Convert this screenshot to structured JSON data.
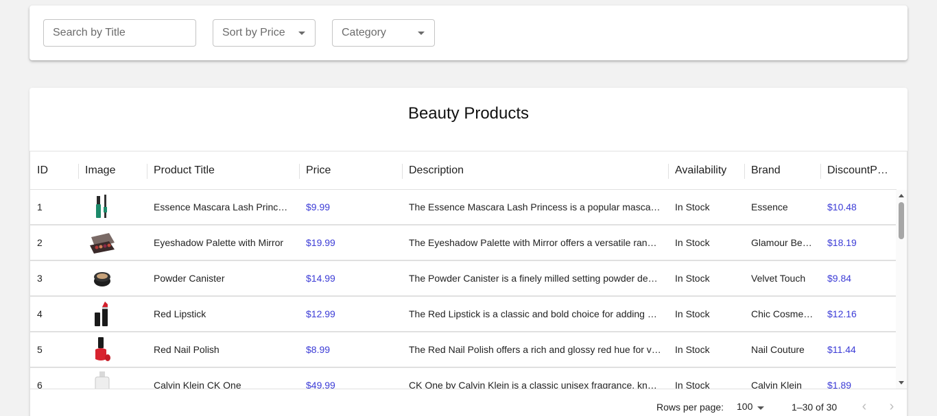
{
  "filters": {
    "search_placeholder": "Search by Title",
    "sort_label": "Sort by Price",
    "category_label": "Category"
  },
  "table": {
    "title": "Beauty Products",
    "columns": [
      "ID",
      "Image",
      "Product Title",
      "Price",
      "Description",
      "Availability",
      "Brand",
      "DiscountP…"
    ],
    "rows": [
      {
        "id": "1",
        "image": "mascara-thumbnail",
        "title": "Essence Mascara Lash Princ…",
        "price": "$9.99",
        "description": "The Essence Mascara Lash Princess is a popular masca…",
        "availability": "In Stock",
        "brand": "Essence",
        "discount": "$10.48"
      },
      {
        "id": "2",
        "image": "eyeshadow-palette-thumbnail",
        "title": "Eyeshadow Palette with Mirror",
        "price": "$19.99",
        "description": "The Eyeshadow Palette with Mirror offers a versatile ran…",
        "availability": "In Stock",
        "brand": "Glamour Be…",
        "discount": "$18.19"
      },
      {
        "id": "3",
        "image": "powder-canister-thumbnail",
        "title": "Powder Canister",
        "price": "$14.99",
        "description": "The Powder Canister is a finely milled setting powder de…",
        "availability": "In Stock",
        "brand": "Velvet Touch",
        "discount": "$9.84"
      },
      {
        "id": "4",
        "image": "red-lipstick-thumbnail",
        "title": "Red Lipstick",
        "price": "$12.99",
        "description": "The Red Lipstick is a classic and bold choice for adding …",
        "availability": "In Stock",
        "brand": "Chic Cosme…",
        "discount": "$12.16"
      },
      {
        "id": "5",
        "image": "red-nail-polish-thumbnail",
        "title": "Red Nail Polish",
        "price": "$8.99",
        "description": "The Red Nail Polish offers a rich and glossy red hue for v…",
        "availability": "In Stock",
        "brand": "Nail Couture",
        "discount": "$11.44"
      },
      {
        "id": "6",
        "image": "perfume-bottle-thumbnail",
        "title": "Calvin Klein CK One",
        "price": "$49.99",
        "description": "CK One by Calvin Klein is a classic unisex fragrance, kn…",
        "availability": "In Stock",
        "brand": "Calvin Klein",
        "discount": "$1.89"
      }
    ]
  },
  "pagination": {
    "rows_per_page_label": "Rows per page:",
    "rows_per_page_value": "100",
    "range": "1–30 of 30"
  },
  "colors": {
    "price_text": "#3b3bd6",
    "background": "#f2f2f2"
  }
}
